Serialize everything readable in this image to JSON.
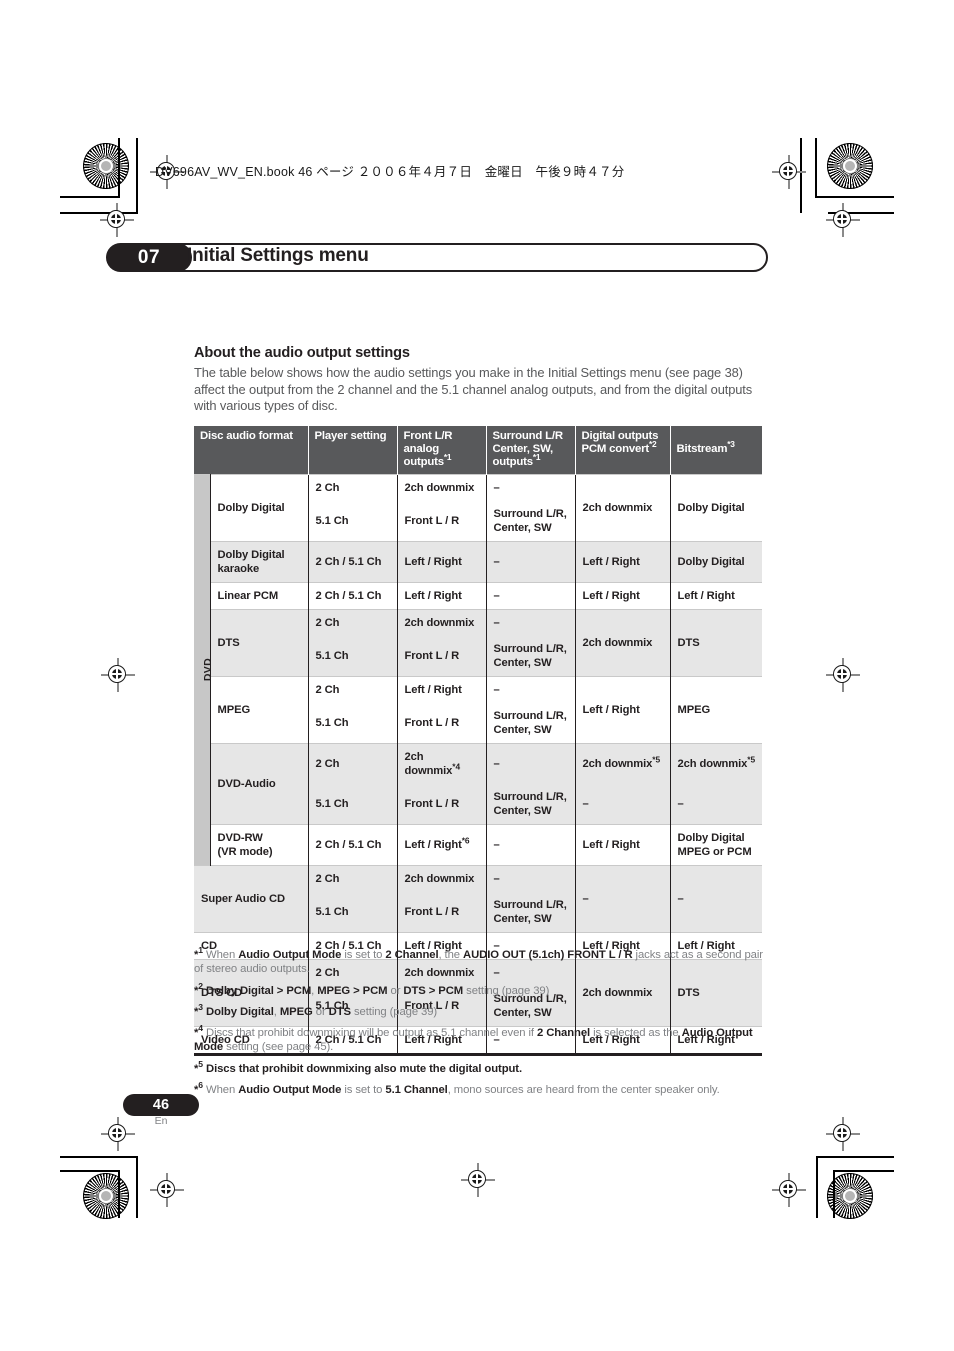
{
  "print_marks": {
    "file_info": "DV696AV_WV_EN.book 46 ページ ２００６年４月７日　金曜日　午後９時４７分"
  },
  "chapter": {
    "number": "07",
    "title": "Initial Settings menu"
  },
  "section": {
    "heading": "About the audio output settings",
    "intro": "The table below shows how the audio settings you make in the Initial Settings menu (see page 38) affect the output from the 2 channel and the 5.1 channel analog outputs, and from the digital outputs with various types of disc."
  },
  "table": {
    "headers": {
      "disc_format": "Disc audio format",
      "player_setting": "Player setting",
      "front_lr_line1": "Front L/R",
      "front_lr_line2": "analog outputs",
      "front_lr_note": "*1",
      "surround_line1": "Surround L/R",
      "surround_line2": "Center, SW, outputs",
      "surround_note": "*1",
      "digital_outputs": "Digital outputs",
      "pcm_convert": "PCM convert",
      "pcm_convert_note": "*2",
      "bitstream": "Bitstream",
      "bitstream_note": "*3"
    },
    "group_label_dvd": "DVD",
    "rows": [
      {
        "format": "Dolby Digital",
        "settings": [
          "2 Ch",
          "5.1 Ch"
        ],
        "front": [
          "2ch downmix",
          "Front L / R"
        ],
        "surround": [
          "–",
          "Surround L/R,\nCenter, SW"
        ],
        "pcm": "2ch downmix",
        "bitstream": "Dolby Digital"
      },
      {
        "format": "Dolby Digital\nkaraoke",
        "settings": [
          "2 Ch / 5.1 Ch"
        ],
        "front": [
          "Left / Right"
        ],
        "surround": [
          "–"
        ],
        "pcm": "Left / Right",
        "bitstream": "Dolby Digital"
      },
      {
        "format": "Linear PCM",
        "settings": [
          "2 Ch / 5.1 Ch"
        ],
        "front": [
          "Left / Right"
        ],
        "surround": [
          "–"
        ],
        "pcm": "Left / Right",
        "bitstream": "Left / Right"
      },
      {
        "format": "DTS",
        "settings": [
          "2 Ch",
          "5.1 Ch"
        ],
        "front": [
          "2ch downmix",
          "Front L / R"
        ],
        "surround": [
          "–",
          "Surround L/R,\nCenter, SW"
        ],
        "pcm": "2ch downmix",
        "bitstream": "DTS"
      },
      {
        "format": "MPEG",
        "settings": [
          "2 Ch",
          "5.1 Ch"
        ],
        "front": [
          "Left / Right",
          "Front L / R"
        ],
        "surround": [
          "–",
          "Surround L/R,\nCenter, SW"
        ],
        "pcm": "Left / Right",
        "bitstream": "MPEG"
      },
      {
        "format": "DVD-Audio",
        "settings": [
          "2 Ch",
          "5.1 Ch"
        ],
        "front": [
          "2ch downmix*4",
          "Front L / R"
        ],
        "surround": [
          "–",
          "Surround L/R,\nCenter, SW"
        ],
        "pcm": [
          "2ch downmix*5",
          "–"
        ],
        "bitstream": [
          "2ch downmix*5",
          "–"
        ]
      },
      {
        "format": "DVD-RW\n(VR mode)",
        "settings": [
          "2 Ch / 5.1 Ch"
        ],
        "front": [
          "Left / Right*6"
        ],
        "surround": [
          "–"
        ],
        "pcm": "Left / Right",
        "bitstream": "Dolby Digital\nMPEG or PCM"
      },
      {
        "format": "Super Audio CD",
        "settings": [
          "2 Ch",
          "5.1 Ch"
        ],
        "front": [
          "2ch downmix",
          "Front L / R"
        ],
        "surround": [
          "–",
          "Surround L/R,\nCenter, SW"
        ],
        "pcm": "–",
        "bitstream": "–"
      },
      {
        "format": "CD",
        "settings": [
          "2 Ch / 5.1 Ch"
        ],
        "front": [
          "Left / Right"
        ],
        "surround": [
          "–"
        ],
        "pcm": "Left / Right",
        "bitstream": "Left / Right"
      },
      {
        "format": "DTS CD",
        "settings": [
          "2 Ch",
          "5.1 Ch"
        ],
        "front": [
          "2ch downmix",
          "Front L / R"
        ],
        "surround": [
          "–",
          "Surround L/R,\nCenter, SW"
        ],
        "pcm": "2ch downmix",
        "bitstream": "DTS"
      },
      {
        "format": "Video CD",
        "settings": [
          "2 Ch / 5.1 Ch"
        ],
        "front": [
          "Left / Right"
        ],
        "surround": [
          "–"
        ],
        "pcm": "Left / Right",
        "bitstream": "Left / Right"
      }
    ]
  },
  "footnotes": [
    {
      "marker": "*1",
      "parts": [
        {
          "t": "When ",
          "b": false
        },
        {
          "t": "Audio Output Mode",
          "b": true
        },
        {
          "t": " is set to ",
          "b": false
        },
        {
          "t": "2 Channel",
          "b": true
        },
        {
          "t": ", the ",
          "b": false
        },
        {
          "t": "AUDIO OUT (5.1ch) FRONT L / R",
          "b": true
        },
        {
          "t": " jacks act as a second pair of stereo audio outputs.",
          "b": false
        }
      ]
    },
    {
      "marker": "*2",
      "parts": [
        {
          "t": "Dolby Digital > PCM",
          "b": true
        },
        {
          "t": ", ",
          "b": false
        },
        {
          "t": "MPEG > PCM",
          "b": true
        },
        {
          "t": " or ",
          "b": false
        },
        {
          "t": "DTS > PCM",
          "b": true
        },
        {
          "t": " setting (page 39)",
          "b": false
        }
      ]
    },
    {
      "marker": "*3",
      "parts": [
        {
          "t": "Dolby Digital",
          "b": true
        },
        {
          "t": ", ",
          "b": false
        },
        {
          "t": "MPEG",
          "b": true
        },
        {
          "t": " or ",
          "b": false
        },
        {
          "t": "DTS",
          "b": true
        },
        {
          "t": " setting (page 39)",
          "b": false
        }
      ]
    },
    {
      "marker": "*4",
      "parts": [
        {
          "t": "Discs that prohibit downmixing will be output as 5.1 channel even if ",
          "b": false
        },
        {
          "t": "2 Channel",
          "b": true
        },
        {
          "t": " is selected as the ",
          "b": false
        },
        {
          "t": "Audio Output Mode",
          "b": true
        },
        {
          "t": " setting (see page 45).",
          "b": false
        }
      ]
    },
    {
      "marker": "*5",
      "parts": [
        {
          "t": "Discs that prohibit downmixing also mute the digital output.",
          "b": true
        }
      ]
    },
    {
      "marker": "*6",
      "parts": [
        {
          "t": "When ",
          "b": false
        },
        {
          "t": "Audio Output Mode",
          "b": true
        },
        {
          "t": " is set to ",
          "b": false
        },
        {
          "t": "5.1 Channel",
          "b": true
        },
        {
          "t": ", mono sources are heard from the center speaker only.",
          "b": false
        }
      ]
    }
  ],
  "footer": {
    "page_number": "46",
    "language": "En"
  },
  "colors": {
    "header_bg": "#58595b",
    "shade_row": "#e6e6e6",
    "group_col": "#c7c7c7",
    "ink": "#231f20",
    "body_text": "#58595b",
    "note_text": "#808285"
  }
}
